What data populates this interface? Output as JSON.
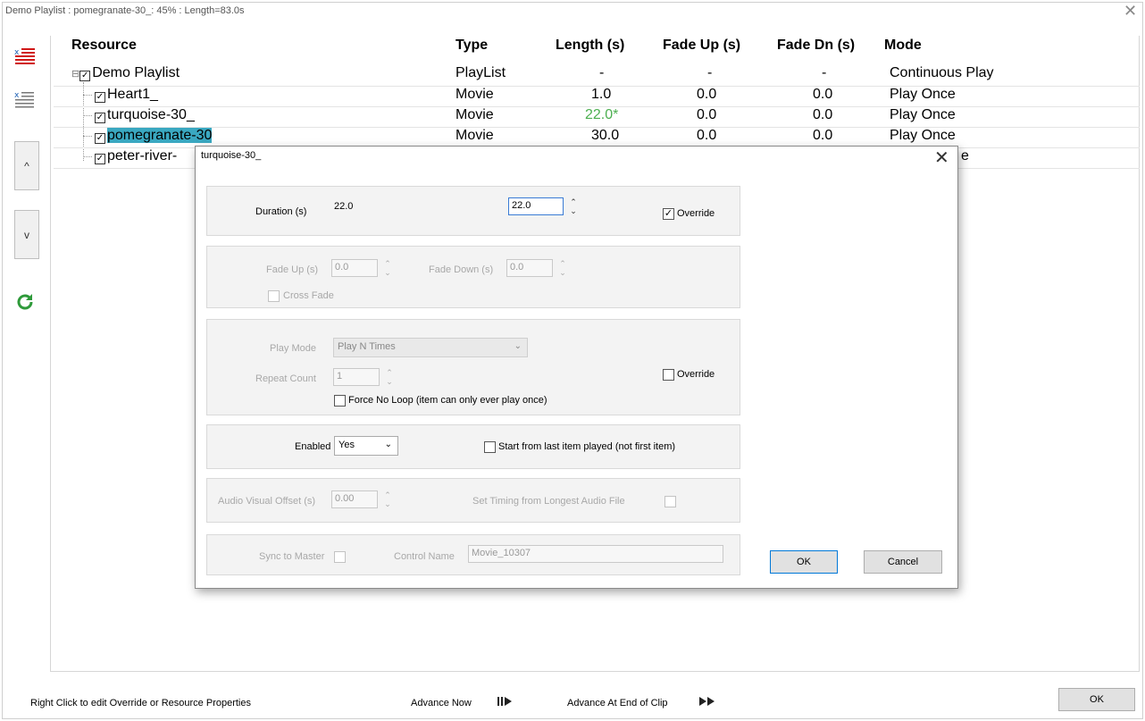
{
  "window": {
    "title": "Demo Playlist : pomegranate-30_: 45% : Length=83.0s",
    "close_glyph": "✕"
  },
  "table": {
    "columns": [
      "Resource",
      "Type",
      "Length (s)",
      "Fade Up (s)",
      "Fade Dn (s)",
      "Mode"
    ],
    "rows": [
      {
        "name": "Demo Playlist",
        "type": "PlayList",
        "length": "-",
        "fade_up": "-",
        "fade_dn": "-",
        "mode": "Continuous Play"
      },
      {
        "name": "Heart1_",
        "type": "Movie",
        "length": "1.0",
        "fade_up": "0.0",
        "fade_dn": "0.0",
        "mode": "Play Once"
      },
      {
        "name": "turquoise-30_",
        "type": "Movie",
        "length": "22.0*",
        "fade_up": "0.0",
        "fade_dn": "0.0",
        "mode": "Play Once"
      },
      {
        "name": "pomegranate-30",
        "type": "Movie",
        "length": "30.0",
        "fade_up": "0.0",
        "fade_dn": "0.0",
        "mode": "Play Once"
      },
      {
        "name": "peter-river-",
        "mode_tail": "e"
      }
    ],
    "override_color": "#4caf50",
    "selection_color": "#3aa8c1"
  },
  "sidebar": {
    "up_label": "^",
    "down_label": "v"
  },
  "dialog": {
    "title": "turquoise-30_",
    "close_glyph": "✕",
    "duration_label": "Duration (s)",
    "duration_value": "22.0",
    "duration_input": "22.0",
    "override_label": "Override",
    "fade_up_label": "Fade Up (s)",
    "fade_up_value": "0.0",
    "fade_down_label": "Fade Down (s)",
    "fade_down_value": "0.0",
    "cross_fade_label": "Cross Fade",
    "play_mode_label": "Play Mode",
    "play_mode_value": "Play N Times",
    "repeat_count_label": "Repeat Count",
    "repeat_count_value": "1",
    "force_no_loop_label": "Force No Loop (item can only ever play once)",
    "override2_label": "Override",
    "enabled_label": "Enabled",
    "enabled_value": "Yes",
    "start_last_label": "Start from last item played (not first item)",
    "av_offset_label": "Audio Visual Offset (s)",
    "av_offset_value": "0.00",
    "timing_longest_label": "Set Timing from Longest Audio File",
    "sync_master_label": "Sync to Master",
    "control_name_label": "Control Name",
    "control_name_value": "Movie_10307",
    "ok_label": "OK",
    "cancel_label": "Cancel"
  },
  "footer": {
    "hint": "Right Click to edit Override or Resource Properties",
    "advance_now": "Advance Now",
    "advance_end": "Advance At End of Clip",
    "ok_label": "OK"
  }
}
